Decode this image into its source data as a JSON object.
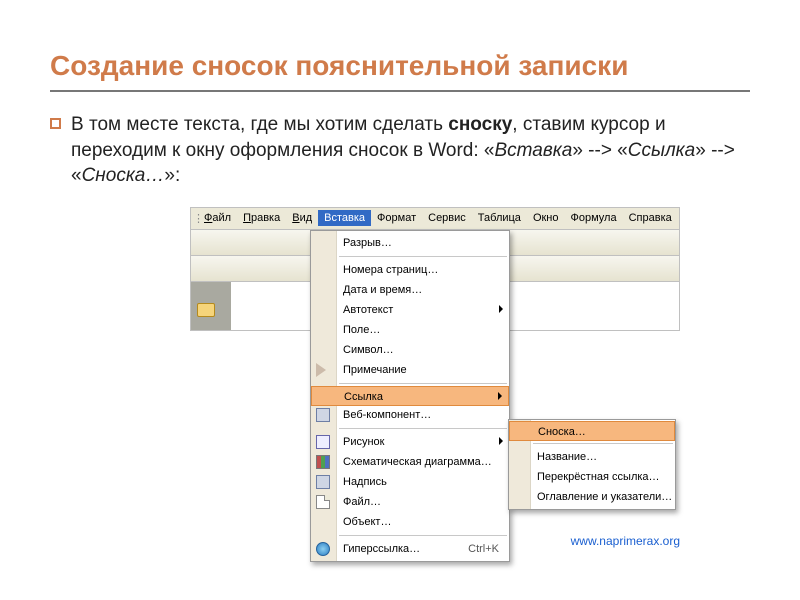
{
  "slide": {
    "title": "Создание сносок пояснительной записки",
    "bullet_pre": "В том месте текста, где мы хотим сделать ",
    "bullet_bold": "сноску",
    "bullet_mid": ", ставим курсор и переходим к окну оформления сносок в Word: «",
    "bullet_it1": "Вставка",
    "bullet_s1": "» --> «",
    "bullet_it2": "Ссылка",
    "bullet_s2": "» --> «",
    "bullet_it3": "Сноска…",
    "bullet_end": "»:"
  },
  "menubar": {
    "items": [
      "Файл",
      "Правка",
      "Вид",
      "Вставка",
      "Формат",
      "Сервис",
      "Таблица",
      "Окно",
      "Формула",
      "Справка"
    ],
    "active_index": 3
  },
  "menu": {
    "items": [
      {
        "label": "Разрыв…",
        "sep_after": true
      },
      {
        "label": "Номера страниц…"
      },
      {
        "label": "Дата и время…"
      },
      {
        "label": "Автотекст",
        "arrow": true
      },
      {
        "label": "Поле…"
      },
      {
        "label": "Символ…"
      },
      {
        "label": "Примечание",
        "icon": "ico-tag",
        "sep_after": true
      },
      {
        "label": "Ссылка",
        "arrow": true,
        "highlight": true
      },
      {
        "label": "Веб-компонент…",
        "icon": "ico-rect",
        "sep_after": true
      },
      {
        "label": "Рисунок",
        "icon": "ico-pic",
        "arrow": true
      },
      {
        "label": "Схематическая диаграмма…",
        "icon": "ico-chart"
      },
      {
        "label": "Надпись",
        "icon": "ico-rect"
      },
      {
        "label": "Файл…",
        "icon": "ico-doc"
      },
      {
        "label": "Объект…",
        "sep_after": true
      },
      {
        "label": "Гиперссылка…",
        "icon": "ico-globe",
        "hotkey": "Ctrl+K"
      }
    ]
  },
  "submenu": {
    "items": [
      {
        "label": "Сноска…",
        "highlight": true
      },
      {
        "label": "Название…"
      },
      {
        "label": "Перекрёстная ссылка…"
      },
      {
        "label": "Оглавление и указатели…"
      }
    ]
  },
  "footer": {
    "url": "www.naprimerax.org"
  }
}
